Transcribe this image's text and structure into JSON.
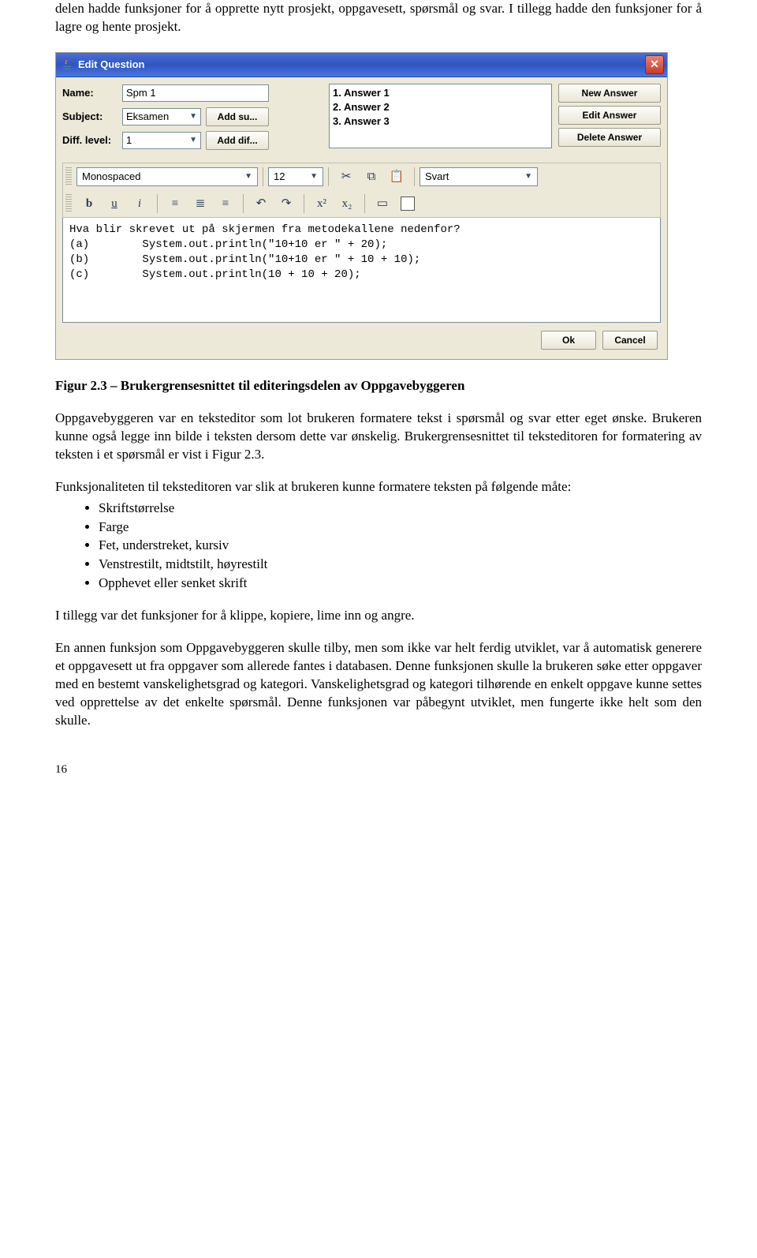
{
  "doc": {
    "intro": "delen hadde funksjoner for å opprette nytt prosjekt, oppgavesett, spørsmål og svar. I tillegg hadde den funksjoner for å lagre og hente prosjekt.",
    "caption": "Figur 2.3 – Brukergrensesnittet til editeringsdelen av Oppgavebyggeren",
    "para1": "Oppgavebyggeren var en teksteditor som lot brukeren formatere tekst i spørsmål og svar etter eget ønske. Brukeren kunne også legge inn bilde i teksten dersom dette var ønskelig. Brukergrensesnittet til teksteditoren for formatering av teksten i et spørsmål er vist i Figur 2.3.",
    "para2_lead": "Funksjonaliteten til teksteditoren var slik at brukeren kunne formatere teksten på følgende måte:",
    "bullets": [
      "Skriftstørrelse",
      "Farge",
      "Fet, understreket, kursiv",
      "Venstrestilt, midtstilt, høyrestilt",
      "Opphevet eller senket skrift"
    ],
    "para3": "I tillegg var det funksjoner for å klippe, kopiere, lime inn og angre.",
    "para4": "En annen funksjon som Oppgavebyggeren skulle tilby, men som ikke var helt ferdig utviklet, var å automatisk generere et oppgavesett ut fra oppgaver som allerede fantes i databasen. Denne funksjonen skulle la brukeren søke etter oppgaver med en bestemt vanskelighetsgrad og kategori. Vanskelighetsgrad og kategori tilhørende en enkelt oppgave kunne settes ved opprettelse av det enkelte spørsmål. Denne funksjonen var påbegynt utviklet, men fungerte ikke helt som den skulle.",
    "page_num": "16"
  },
  "win": {
    "title": "Edit Question",
    "labels": {
      "name": "Name:",
      "subject": "Subject:",
      "diff": "Diff. level:"
    },
    "name_value": "Spm 1",
    "subject_value": "Eksamen",
    "add_subject": "Add su...",
    "diff_value": "1",
    "add_diff": "Add dif...",
    "answers": [
      "1. Answer 1",
      "2. Answer 2",
      "3. Answer 3"
    ],
    "buttons": {
      "new_answer": "New Answer",
      "edit_answer": "Edit Answer",
      "delete_answer": "Delete Answer",
      "ok": "Ok",
      "cancel": "Cancel"
    },
    "toolbar": {
      "font": "Monospaced",
      "size": "12",
      "color": "Svart"
    },
    "editor_lines": [
      "Hva blir skrevet ut på skjermen fra metodekallene nedenfor?",
      "(a)        System.out.println(\"10+10 er \" + 20);",
      "(b)        System.out.println(\"10+10 er \" + 10 + 10);",
      "(c)        System.out.println(10 + 10 + 20);"
    ]
  }
}
